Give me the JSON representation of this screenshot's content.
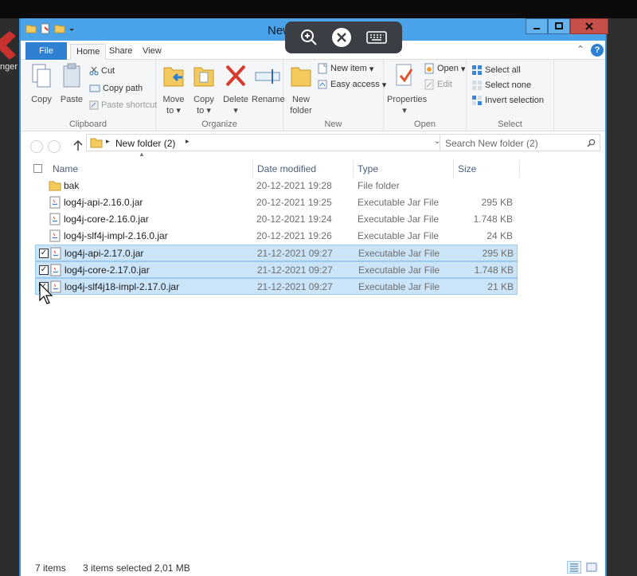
{
  "left_strip": {
    "peek_text": "nger"
  },
  "window": {
    "title": "New"
  },
  "tabs": {
    "file": "File",
    "home": "Home",
    "share": "Share",
    "view": "View"
  },
  "ribbon": {
    "clipboard": {
      "label": "Clipboard",
      "copy": "Copy",
      "paste": "Paste",
      "cut": "Cut",
      "copy_path": "Copy path",
      "paste_shortcut": "Paste shortcut"
    },
    "organize": {
      "label": "Organize",
      "move_to_1": "Move",
      "move_to_2": "to",
      "copy_to_1": "Copy",
      "copy_to_2": "to",
      "delete": "Delete",
      "rename": "Rename"
    },
    "new": {
      "label": "New",
      "new_folder_1": "New",
      "new_folder_2": "folder",
      "new_item": "New item",
      "easy_access": "Easy access"
    },
    "open": {
      "label": "Open",
      "properties": "Properties",
      "open": "Open",
      "edit": "Edit"
    },
    "select": {
      "label": "Select",
      "select_all": "Select all",
      "select_none": "Select none",
      "invert": "Invert selection"
    }
  },
  "address": {
    "path": "New folder (2)",
    "search_placeholder": "Search New folder (2)"
  },
  "columns": {
    "name": "Name",
    "date": "Date modified",
    "type": "Type",
    "size": "Size"
  },
  "files": [
    {
      "name": "bak",
      "date": "20-12-2021 19:28",
      "type": "File folder",
      "size": "",
      "selected": false,
      "icon": "folder-icon"
    },
    {
      "name": "log4j-api-2.16.0.jar",
      "date": "20-12-2021 19:25",
      "type": "Executable Jar File",
      "size": "295 KB",
      "selected": false,
      "icon": "jar-file-icon"
    },
    {
      "name": "log4j-core-2.16.0.jar",
      "date": "20-12-2021 19:24",
      "type": "Executable Jar File",
      "size": "1.748 KB",
      "selected": false,
      "icon": "jar-file-icon"
    },
    {
      "name": "log4j-slf4j-impl-2.16.0.jar",
      "date": "20-12-2021 19:26",
      "type": "Executable Jar File",
      "size": "24 KB",
      "selected": false,
      "icon": "jar-file-icon"
    },
    {
      "name": "log4j-api-2.17.0.jar",
      "date": "21-12-2021 09:27",
      "type": "Executable Jar File",
      "size": "295 KB",
      "selected": true,
      "icon": "jar-file-icon"
    },
    {
      "name": "log4j-core-2.17.0.jar",
      "date": "21-12-2021 09:27",
      "type": "Executable Jar File",
      "size": "1.748 KB",
      "selected": true,
      "icon": "jar-file-icon"
    },
    {
      "name": "log4j-slf4j18-impl-2.17.0.jar",
      "date": "21-12-2021 09:27",
      "type": "Executable Jar File",
      "size": "21 KB",
      "selected": true,
      "icon": "jar-file-icon"
    }
  ],
  "status": {
    "count": "7 items",
    "selection": "3 items selected  2,01 MB"
  },
  "colors": {
    "accent": "#2f7fd2",
    "titlebar": "#4aa3e8",
    "selection": "#cce4f7"
  }
}
